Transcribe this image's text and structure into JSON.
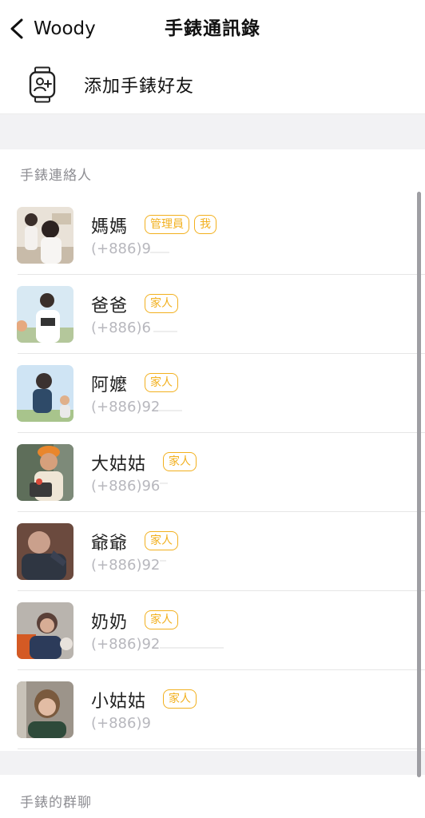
{
  "header": {
    "back_label": "Woody",
    "title": "手錶通訊錄"
  },
  "add_friend": {
    "label": "添加手錶好友",
    "icon": "watch-add-user-icon"
  },
  "sections": {
    "contacts_title": "手錶連絡人",
    "groups_title": "手錶的群聊"
  },
  "accent_color": "#f2b01e",
  "contacts": [
    {
      "name": "媽媽",
      "badges": [
        "管理員",
        "我"
      ],
      "phone": "(+886)9"
    },
    {
      "name": "爸爸",
      "badges": [
        "家人"
      ],
      "phone": "(+886)6"
    },
    {
      "name": "阿嬤",
      "badges": [
        "家人"
      ],
      "phone": "(+886)92"
    },
    {
      "name": "大姑姑",
      "badges": [
        "家人"
      ],
      "phone": "(+886)96"
    },
    {
      "name": "爺爺",
      "badges": [
        "家人"
      ],
      "phone": "(+886)92"
    },
    {
      "name": "奶奶",
      "badges": [
        "家人"
      ],
      "phone": "(+886)92"
    },
    {
      "name": "小姑姑",
      "badges": [
        "家人"
      ],
      "phone": "(+886)9"
    }
  ]
}
